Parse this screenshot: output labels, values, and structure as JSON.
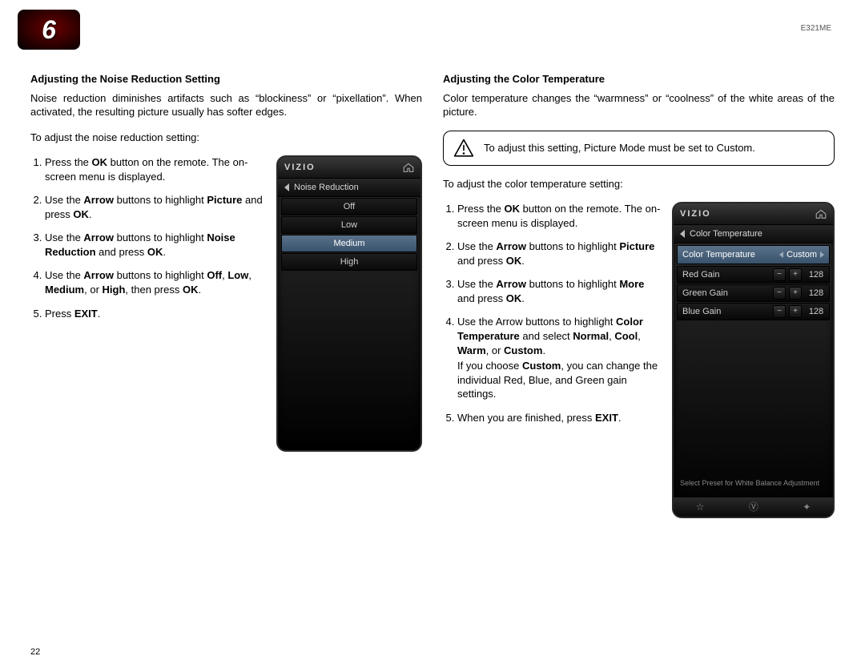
{
  "chapter": "6",
  "model": "E321ME",
  "pageNumber": "22",
  "left": {
    "title": "Adjusting the Noise Reduction Setting",
    "intro": "Noise reduction diminishes artifacts such as “blockiness” or “pixellation”. When activated, the resulting picture usually has softer edges.",
    "lead": "To adjust the noise reduction setting:",
    "steps": [
      "Press the <b>OK</b> button on the remote. The on-screen menu is displayed.",
      "Use the <b>Arrow</b> buttons to highlight <b>Picture</b> and press <b>OK</b>.",
      "Use the <b>Arrow</b> buttons to highlight <b>Noise Reduction</b> and press <b>OK</b>.",
      "Use the <b>Arrow</b> buttons to highlight <b>Off</b>, <b>Low</b>, <b>Medium</b>, or <b>High</b>, then press <b>OK</b>.",
      "Press <b>EXIT</b>."
    ],
    "menu": {
      "brand": "VIZIO",
      "title": "Noise Reduction",
      "options": [
        "Off",
        "Low",
        "Medium",
        "High"
      ],
      "selected": "Medium"
    }
  },
  "right": {
    "title": "Adjusting the Color Temperature",
    "intro": "Color temperature changes the “warmness” or “coolness” of the white areas of the picture.",
    "notice": "To adjust this setting, Picture Mode must be set to Custom.",
    "lead": "To adjust the color temperature setting:",
    "steps": [
      "Press the <b>OK</b> button on the remote. The on-screen menu is displayed.",
      "Use the <b>Arrow</b> buttons to highlight <b>Picture</b> and press <b>OK</b>.",
      "Use the <b>Arrow</b> buttons to highlight <b>More</b> and press <b>OK</b>.",
      "Use the Arrow buttons to highlight <b>Color Temperature</b> and select <b>Normal</b>, <b>Cool</b>, <b>Warm</b>, or <b>Custom</b>.",
      "When you are finished, press <b>EXIT</b>."
    ],
    "stepsAfter4": "If you choose <b>Custom</b>, you can change the individual Red, Blue, and Green gain settings.",
    "menu": {
      "brand": "VIZIO",
      "title": "Color Temperature",
      "modeLabel": "Color Temperature",
      "modeValue": "Custom",
      "rows": [
        {
          "label": "Red Gain",
          "value": "128"
        },
        {
          "label": "Green Gain",
          "value": "128"
        },
        {
          "label": "Blue Gain",
          "value": "128"
        }
      ],
      "hint": "Select Preset for White Balance Adjustment"
    }
  }
}
